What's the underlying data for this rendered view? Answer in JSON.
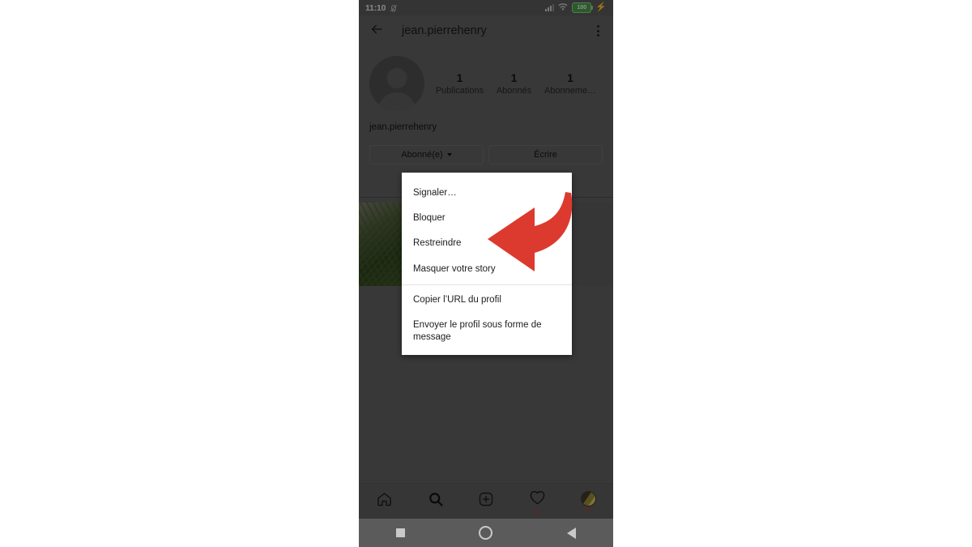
{
  "status_bar": {
    "time": "11:10",
    "silent_icon": "bell-muted-icon",
    "signal_icon": "signal-bars-icon",
    "wifi_icon": "wifi-icon",
    "battery_level": "100",
    "charging_icon": "lightning-bolt-icon"
  },
  "app_header": {
    "back_icon": "back-arrow-icon",
    "title": "jean.pierrehenry",
    "overflow_icon": "kebab-menu-icon"
  },
  "profile": {
    "avatar_icon": "default-avatar-icon",
    "username": "jean.pierrehenry",
    "stats": [
      {
        "count": "1",
        "label": "Publications"
      },
      {
        "count": "1",
        "label": "Abonnés"
      },
      {
        "count": "1",
        "label": "Abonneme…"
      }
    ],
    "buttons": [
      {
        "label": "Abonné(e)",
        "has_caret": true
      },
      {
        "label": "Écrire",
        "has_caret": false
      }
    ]
  },
  "menu": {
    "groups": [
      {
        "items": [
          {
            "label": "Signaler…"
          },
          {
            "label": "Bloquer"
          },
          {
            "label": "Restreindre"
          },
          {
            "label": "Masquer votre story"
          }
        ]
      },
      {
        "items": [
          {
            "label": "Copier l’URL du profil"
          },
          {
            "label": "Envoyer le profil sous forme de message"
          }
        ]
      }
    ]
  },
  "annotation": {
    "arrow_icon": "curved-left-arrow-icon",
    "arrow_color": "#DC3A2E",
    "points_to": "Restreindre"
  },
  "bottom_nav": {
    "items": [
      {
        "icon": "home-icon",
        "badge": false
      },
      {
        "icon": "search-icon",
        "badge": false
      },
      {
        "icon": "add-post-icon",
        "badge": false
      },
      {
        "icon": "heart-activity-icon",
        "badge": true
      },
      {
        "icon": "profile-avatar-icon",
        "badge": true
      }
    ]
  },
  "system_nav": {
    "items": [
      {
        "icon": "recents-square-icon"
      },
      {
        "icon": "home-circle-icon"
      },
      {
        "icon": "back-triangle-icon"
      }
    ]
  },
  "colors": {
    "scrim": "#595959",
    "menu_bg": "#FFFFFF",
    "accent_red": "#DC3A2E",
    "badge_red": "#B23B32"
  }
}
